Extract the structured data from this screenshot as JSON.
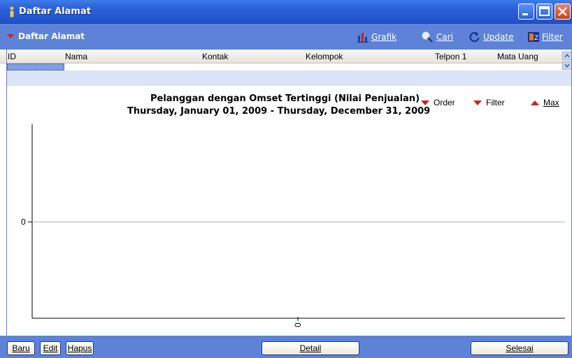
{
  "window": {
    "title": "Daftar Alamat",
    "colors": {
      "titlebar": "#2a5fd6",
      "toolbar": "#5d82d8",
      "accent_red": "#d11e1e"
    }
  },
  "toolbar": {
    "section_title": "Daftar Alamat",
    "buttons": [
      {
        "label": "Grafik",
        "icon": "chart-icon"
      },
      {
        "label": "Cari",
        "icon": "search-icon"
      },
      {
        "label": "Update",
        "icon": "refresh-icon"
      },
      {
        "label": "Filter",
        "icon": "filter-icon"
      }
    ]
  },
  "table": {
    "columns": [
      "ID",
      "Nama",
      "Kontak",
      "Kelompok",
      "Telpon 1",
      "Mata Uang"
    ]
  },
  "chart_options": {
    "order": "Order",
    "filter": "Filter",
    "max": "Max"
  },
  "chart_data": {
    "type": "bar",
    "title": "Pelanggan dengan Omset Tertinggi (Nilai Penjualan)",
    "subtitle": "Thursday, January 01, 2009 - Thursday, December 31, 2009",
    "categories": [
      "0"
    ],
    "values": [
      0
    ],
    "y_ticks": [
      "0"
    ],
    "grid": true
  },
  "footer": {
    "buttons": {
      "new": "Baru",
      "edit": "Edit",
      "delete": "Hapus",
      "detail": "Detail",
      "done": "Selesai"
    }
  }
}
